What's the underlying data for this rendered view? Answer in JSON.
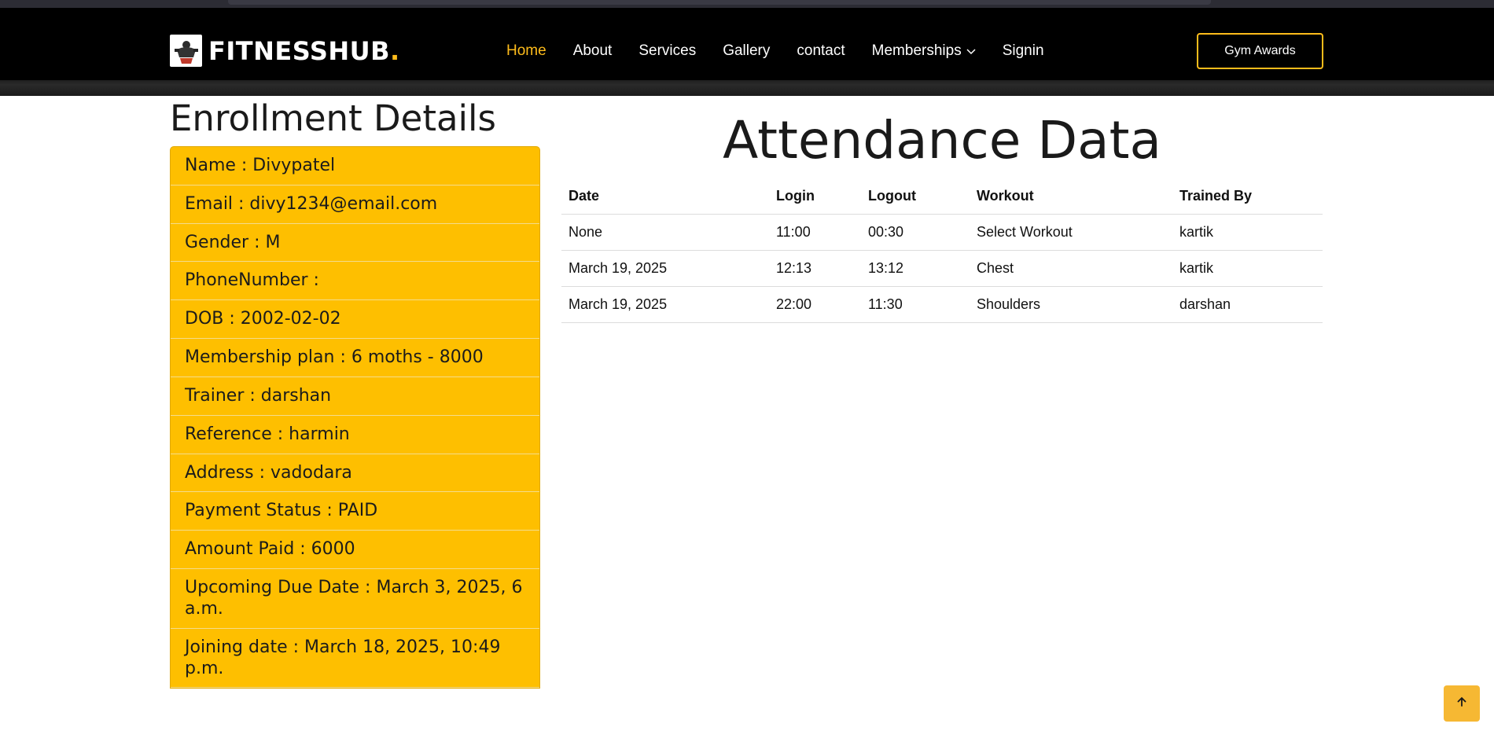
{
  "brand": {
    "name": "FITNESSHUB",
    "dot": "."
  },
  "nav": {
    "items": [
      {
        "label": "Home",
        "active": true
      },
      {
        "label": "About"
      },
      {
        "label": "Services"
      },
      {
        "label": "Gallery"
      },
      {
        "label": "contact"
      },
      {
        "label": "Memberships",
        "dropdown": true
      },
      {
        "label": "Signin"
      }
    ],
    "cta": "Gym Awards"
  },
  "enrollment": {
    "title": "Enrollment Details",
    "rows": [
      "Name : Divypatel",
      "Email : divy1234@email.com",
      "Gender : M",
      "PhoneNumber :",
      "DOB : 2002-02-02",
      "Membership plan : 6 moths - 8000",
      "Trainer : darshan",
      "Reference : harmin",
      "Address : vadodara",
      "Payment Status : PAID",
      "Amount Paid : 6000",
      "Upcoming Due Date : March 3, 2025, 6 a.m.",
      "Joining date : March 18, 2025, 10:49 p.m."
    ]
  },
  "attendance": {
    "title": "Attendance Data",
    "columns": [
      "Date",
      "Login",
      "Logout",
      "Workout",
      "Trained By"
    ],
    "rows": [
      [
        "None",
        "11:00",
        "00:30",
        "Select Workout",
        "kartik"
      ],
      [
        "March 19, 2025",
        "12:13",
        "13:12",
        "Chest",
        "kartik"
      ],
      [
        "March 19, 2025",
        "22:00",
        "11:30",
        "Shoulders",
        "darshan"
      ]
    ]
  },
  "colors": {
    "accent": "#febc1b",
    "card": "#febf00",
    "header": "#000000"
  },
  "icons": {
    "scroll_top": "arrow-up-icon",
    "dropdown": "chevron-down-icon",
    "logo": "bodybuilder-logo-icon"
  }
}
